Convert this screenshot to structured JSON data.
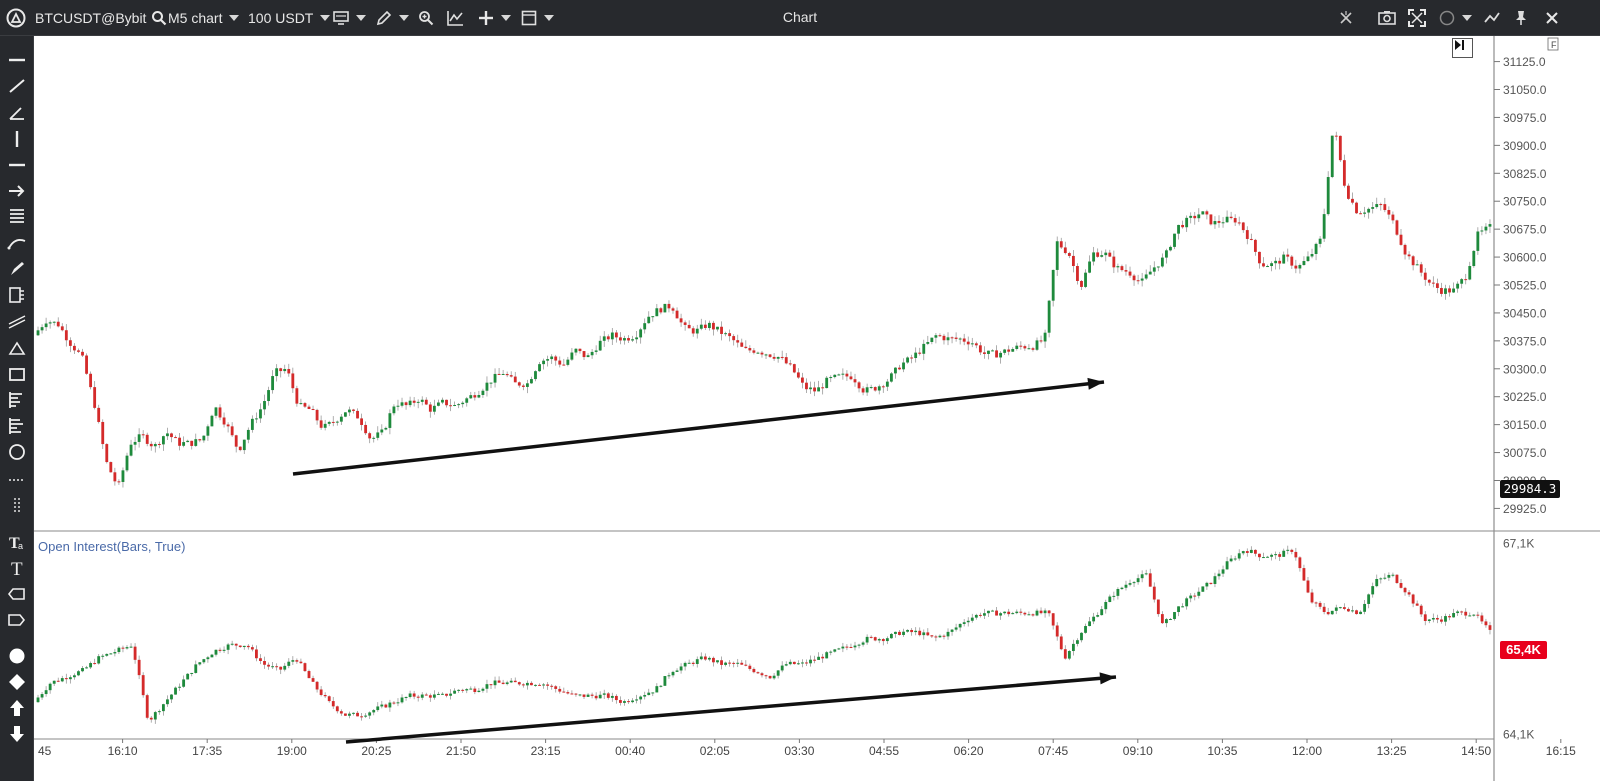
{
  "toolbar": {
    "symbol": "BTCUSDT@Bybit",
    "timeframe": "M5 chart",
    "volume": "100 USDT",
    "title": "Chart"
  },
  "colors": {
    "up": "#1e8a3c",
    "down": "#d42a2a",
    "background": "#ffffff",
    "ui_dark": "#27292d",
    "grid_text": "#555555",
    "oi_badge": "#e8001c"
  },
  "price_axis": {
    "ticks": [
      "31125.0",
      "31050.0",
      "30975.0",
      "30900.0",
      "30825.0",
      "30750.0",
      "30675.0",
      "30600.0",
      "30525.0",
      "30450.0",
      "30375.0",
      "30300.0",
      "30225.0",
      "30150.0",
      "30075.0",
      "30000.0",
      "29925.0"
    ],
    "current": "29984.3",
    "corner_label": "F"
  },
  "oi_axis": {
    "label": "Open Interest(Bars, True)",
    "ticks": [
      "67,1K",
      "64,1K"
    ],
    "current": "65,4K"
  },
  "time_axis": [
    "45",
    "16:10",
    "17:35",
    "19:00",
    "20:25",
    "21:50",
    "23:15",
    "00:40",
    "02:05",
    "03:30",
    "04:55",
    "06:20",
    "07:45",
    "09:10",
    "10:35",
    "12:00",
    "13:25",
    "14:50",
    "16:15"
  ],
  "left_tools": [
    "horizontal-line-icon",
    "trend-line-icon",
    "angle-icon",
    "vertical-line-icon",
    "ray-icon",
    "arrow-icon",
    "fib-icon",
    "curve-icon",
    "brush-icon",
    "ruler-icon",
    "channel-icon",
    "triangle-icon",
    "rectangle-icon",
    "fib-fan-icon",
    "volume-profile-icon",
    "circle-icon",
    "dotted-line-icon",
    "dotted-vertical-icon",
    "text-format-icon",
    "text-icon",
    "label-icon",
    "tag-icon",
    "dot-icon",
    "diamond-icon",
    "arrow-up-icon",
    "arrow-down-icon"
  ],
  "chart_data": {
    "type": "candlestick",
    "price_series": [
      30390,
      30430,
      30420,
      30370,
      30330,
      30210,
      30050,
      29980,
      30100,
      30120,
      30090,
      30130,
      30100,
      30100,
      30110,
      30200,
      30150,
      30080,
      30150,
      30200,
      30290,
      30300,
      30200,
      30190,
      30140,
      30160,
      30190,
      30170,
      30110,
      30130,
      30210,
      30200,
      30220,
      30190,
      30210,
      30200,
      30220,
      30240,
      30270,
      30290,
      30260,
      30260,
      30320,
      30330,
      30310,
      30350,
      30330,
      30370,
      30390,
      30380,
      30390,
      30440,
      30460,
      30470,
      30410,
      30400,
      30420,
      30400,
      30380,
      30350,
      30350,
      30340,
      30330,
      30300,
      30250,
      30240,
      30270,
      30280,
      30280,
      30240,
      30250,
      30270,
      30310,
      30330,
      30360,
      30390,
      30380,
      30380,
      30370,
      30340,
      30340,
      30350,
      30360,
      30360,
      30380,
      30640,
      30610,
      30520,
      30610,
      30610,
      30570,
      30560,
      30530,
      30570,
      30600,
      30680,
      30700,
      30720,
      30690,
      30700,
      30700,
      30650,
      30580,
      30580,
      30600,
      30570,
      30600,
      30650,
      30960,
      30780,
      30720,
      30730,
      30740,
      30690,
      30610,
      30570,
      30530,
      30510,
      30510,
      30550,
      30660,
      30680
    ],
    "open_interest_series": [
      64.6,
      64.9,
      65.0,
      65.1,
      65.3,
      65.4,
      65.5,
      64.3,
      64.6,
      64.9,
      65.2,
      65.4,
      65.5,
      65.5,
      65.2,
      65.1,
      65.3,
      64.9,
      64.6,
      64.4,
      64.4,
      64.5,
      64.6,
      64.7,
      64.7,
      64.7,
      64.8,
      64.8,
      64.9,
      64.9,
      64.9,
      64.9,
      64.8,
      64.7,
      64.7,
      64.7,
      64.6,
      64.7,
      64.8,
      65.1,
      65.2,
      65.3,
      65.2,
      65.2,
      65.1,
      65.0,
      65.2,
      65.2,
      65.3,
      65.4,
      65.5,
      65.6,
      65.6,
      65.7,
      65.7,
      65.6,
      65.7,
      65.9,
      66.0,
      66.0,
      66.0,
      66.0,
      66.0,
      65.3,
      65.7,
      66.0,
      66.3,
      66.5,
      66.6,
      65.8,
      66.1,
      66.3,
      66.5,
      66.8,
      67.0,
      66.9,
      66.9,
      67.0,
      66.2,
      66.0,
      66.1,
      66.0,
      66.5,
      66.6,
      66.3,
      65.9,
      65.9,
      66.0,
      66.0,
      65.7
    ],
    "price_range": [
      29910,
      31140
    ],
    "oi_range": [
      64.1,
      67.1
    ],
    "annotations": [
      "arrow from 20:25 low to 09:10 (price rising)",
      "arrow from 20:25 to 10:35 (open interest rising)"
    ]
  }
}
